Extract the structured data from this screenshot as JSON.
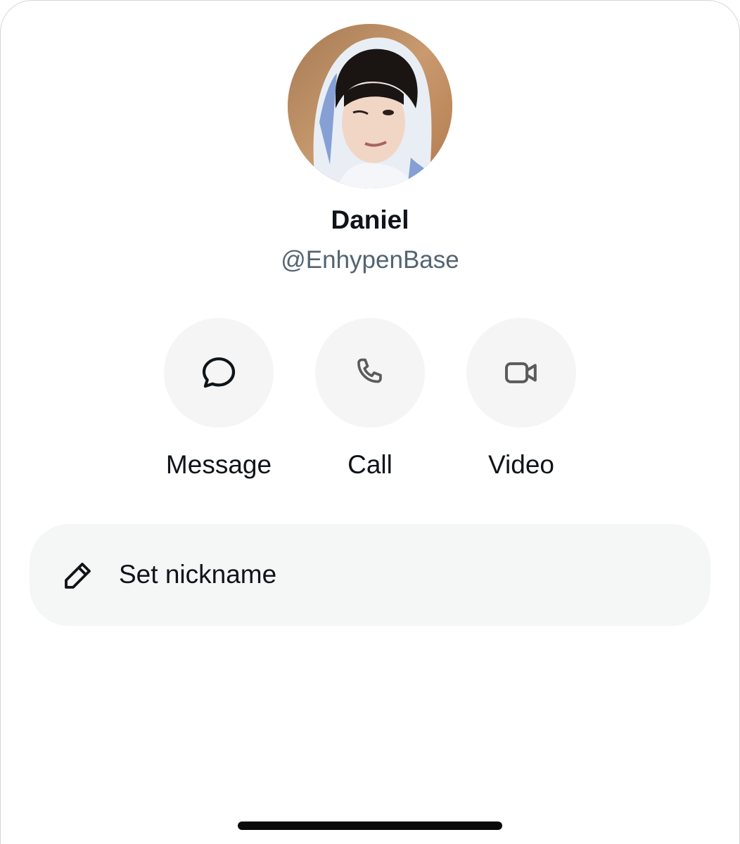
{
  "profile": {
    "name": "Daniel",
    "handle": "@EnhypenBase",
    "avatar_icon": "profile-photo"
  },
  "actions": [
    {
      "label": "Message",
      "icon": "chat-bubble-icon"
    },
    {
      "label": "Call",
      "icon": "phone-icon"
    },
    {
      "label": "Video",
      "icon": "video-camera-icon"
    }
  ],
  "nickname": {
    "label": "Set nickname",
    "icon": "pencil-icon"
  },
  "colors": {
    "text_primary": "#0f1419",
    "text_secondary": "#536471",
    "button_bg": "#f5f5f5",
    "icon_muted": "#5b5b5b"
  }
}
